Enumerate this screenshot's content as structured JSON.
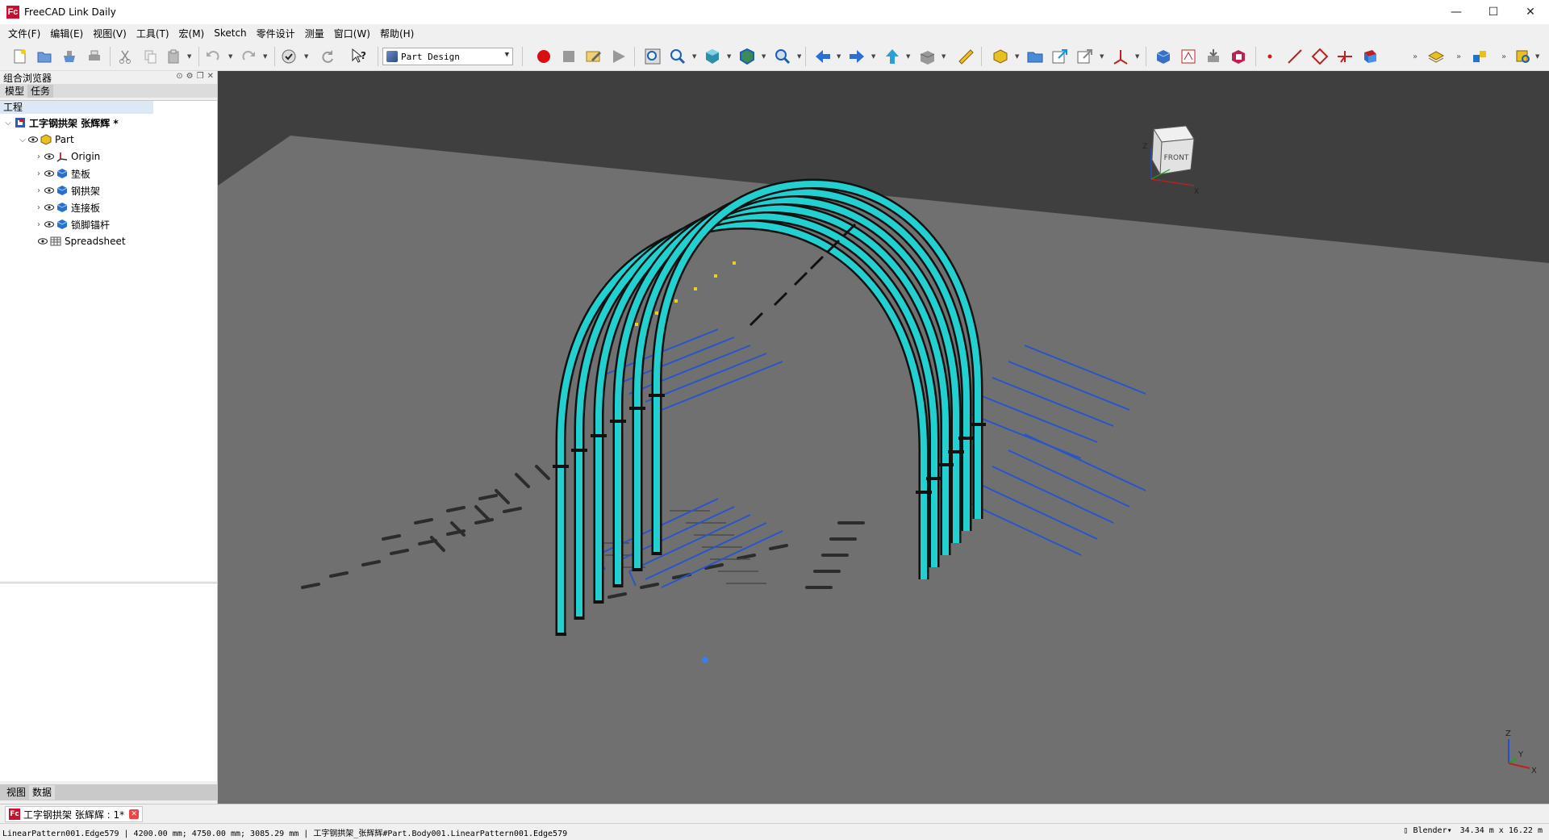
{
  "window": {
    "title": "FreeCAD Link Daily",
    "app_icon": "Fc",
    "minimize": "—",
    "maximize": "☐",
    "close": "✕"
  },
  "menu": [
    "文件(F)",
    "编辑(E)",
    "视图(V)",
    "工具(T)",
    "宏(M)",
    "Sketch",
    "零件设计",
    "测量",
    "窗口(W)",
    "帮助(H)"
  ],
  "toolbar": {
    "workbench": "Part Design"
  },
  "combo_view": {
    "title": "组合浏览器",
    "tabs": [
      "模型",
      "任务"
    ],
    "tree_header": "工程",
    "tree": {
      "document": "工字钢拱架 张辉辉 *",
      "part": "Part",
      "children": [
        "Origin",
        "垫板",
        "钢拱架",
        "连接板",
        "锁脚锚杆"
      ],
      "spreadsheet": "Spreadsheet"
    },
    "bottom_tabs": [
      "视图",
      "数据"
    ]
  },
  "navcube": {
    "face": "FRONT",
    "axis_z": "Z",
    "axis_x": "X"
  },
  "axes": {
    "z": "Z",
    "y": "Y",
    "x": "X"
  },
  "doc_tab": {
    "label": "工字钢拱架 张辉辉 : 1*"
  },
  "status": {
    "message": "LinearPattern001.Edge579 | 4200.00 mm; 4750.00 mm; 3085.29 mm | 工字钢拱架_张辉辉#Part.Body001.LinearPattern001.Edge579",
    "nav_style": "Blender",
    "dimensions": "34.34 m x 16.22 m"
  },
  "colors": {
    "viewport_top": "#3f3f3f",
    "ground": "#707070",
    "arch": "#22d0d0",
    "anchor": "#2a55c8"
  }
}
